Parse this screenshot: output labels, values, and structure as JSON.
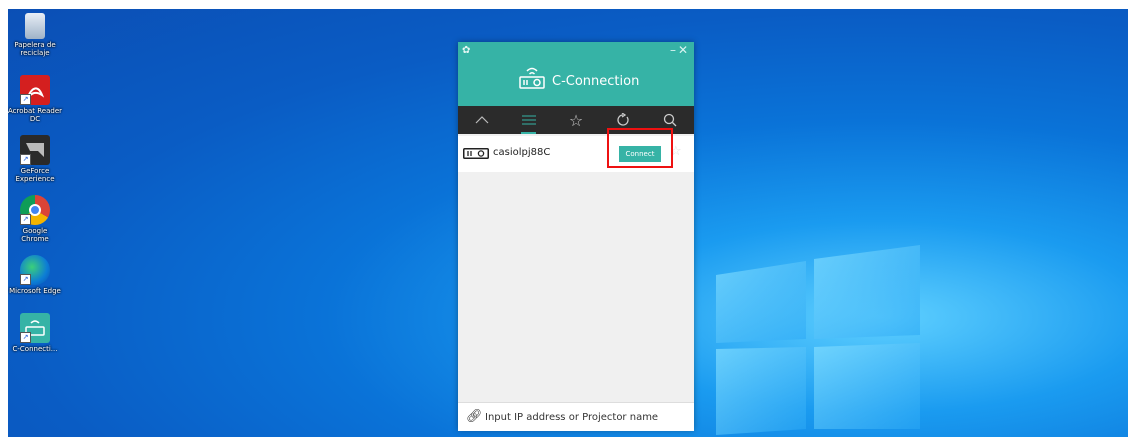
{
  "desktop": {
    "icons": [
      {
        "label": "Papelera de reciclaje",
        "icon": "recycle-bin-icon"
      },
      {
        "label": "Acrobat Reader DC",
        "icon": "acrobat-icon"
      },
      {
        "label": "GeForce Experience",
        "icon": "geforce-icon"
      },
      {
        "label": "Google Chrome",
        "icon": "chrome-icon"
      },
      {
        "label": "Microsoft Edge",
        "icon": "edge-icon"
      },
      {
        "label": "C-Connecti...",
        "icon": "c-connection-icon"
      }
    ]
  },
  "app": {
    "title": "C-Connection",
    "accent_color": "#36b3a6",
    "tabs": [
      {
        "name": "collapse",
        "icon": "chevron-up-icon"
      },
      {
        "name": "list",
        "icon": "list-icon",
        "active": true
      },
      {
        "name": "favorites",
        "icon": "star-icon"
      },
      {
        "name": "refresh",
        "icon": "refresh-icon"
      },
      {
        "name": "search",
        "icon": "search-icon"
      }
    ],
    "device": {
      "name": "casiolpj88C",
      "connect_label": "Connect"
    },
    "input": {
      "placeholder": "Input IP address or Projector name"
    }
  }
}
